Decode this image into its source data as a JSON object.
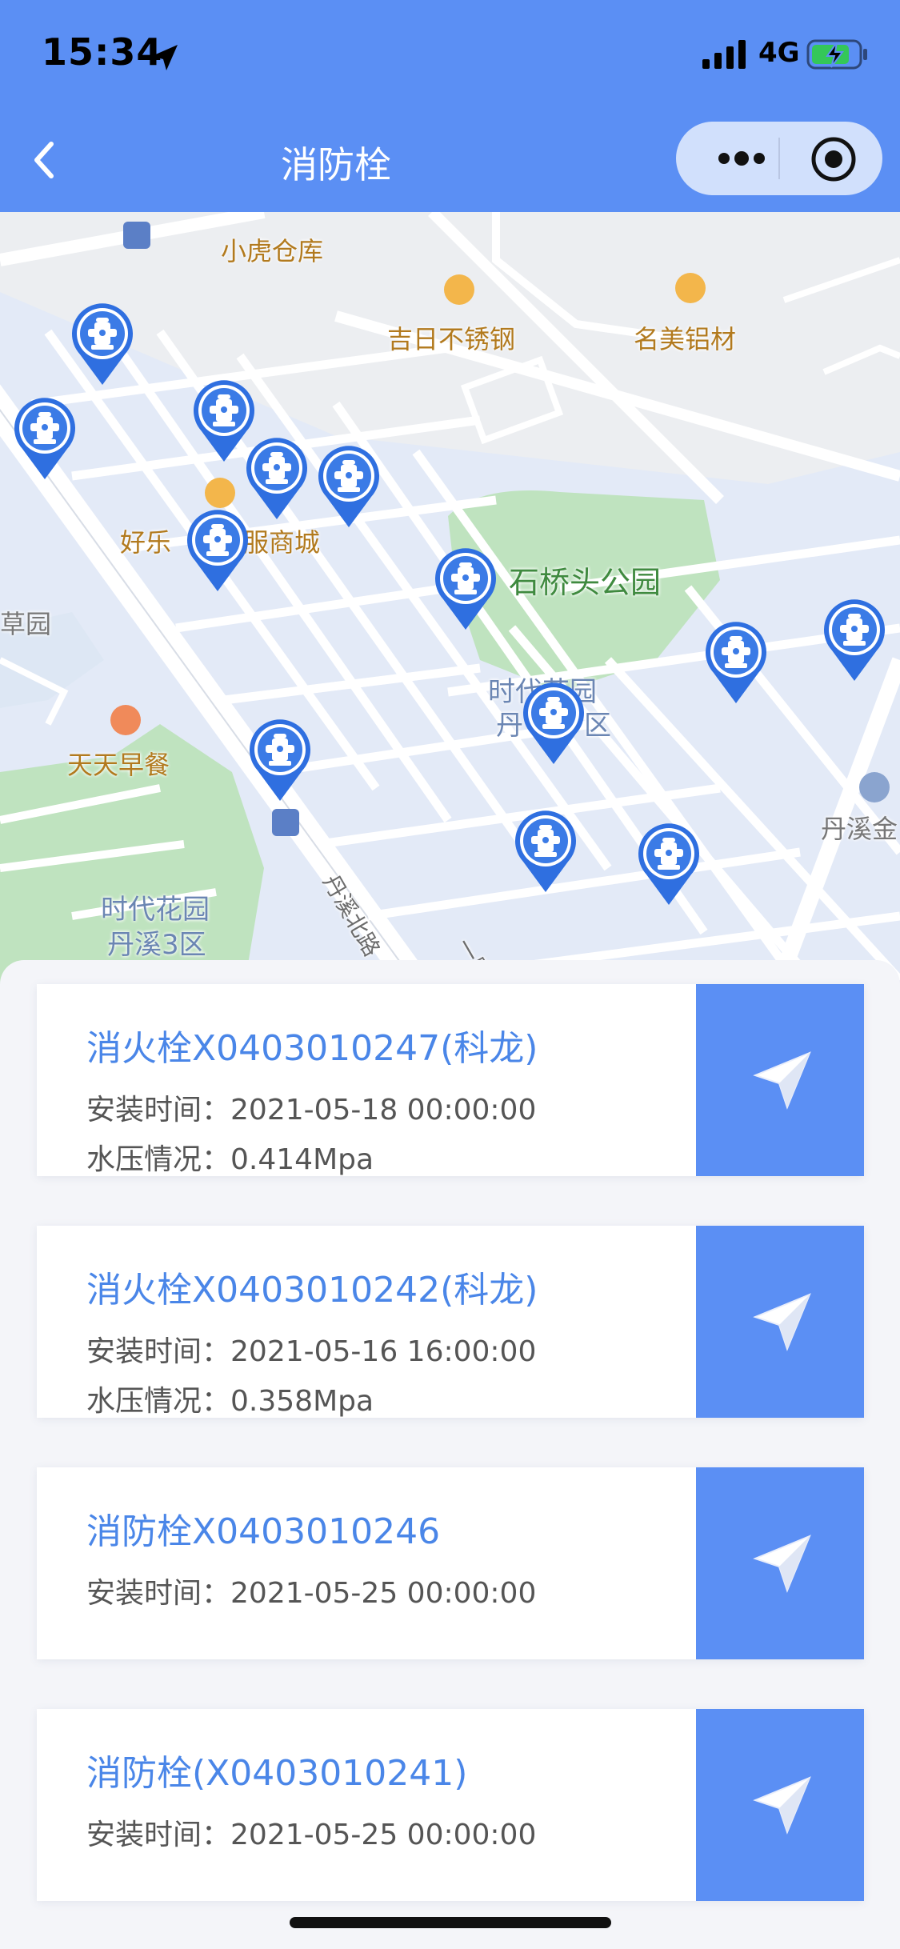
{
  "status_bar": {
    "time": "15:34",
    "network": "4G"
  },
  "nav": {
    "title": "消防栓"
  },
  "map": {
    "labels": {
      "xiaohu": "小虎仓库",
      "jiri": "吉日不锈钢",
      "mingmei": "名美铝材",
      "haole_a": "好乐",
      "haole_b": "服商城",
      "park": "石桥头公园",
      "caoyuan": "草园",
      "breakfast": "天天早餐",
      "shidai_a1": "时代花园",
      "shidai_a2": "丹",
      "shidai_a3": "区",
      "shidai_b1": "时代花园",
      "shidai_b2": "丹溪3区",
      "danxi": "丹溪金",
      "road1": "丹溪北路",
      "road2": "一路"
    }
  },
  "hydrants": [
    {
      "name": "消火栓X0403010247(科龙)",
      "install_label": "安装时间：",
      "install_time": "2021-05-18 00:00:00",
      "pressure_label": "水压情况：",
      "pressure": "0.414Mpa"
    },
    {
      "name": "消火栓X0403010242(科龙)",
      "install_label": "安装时间：",
      "install_time": "2021-05-16 16:00:00",
      "pressure_label": "水压情况：",
      "pressure": "0.358Mpa"
    },
    {
      "name": "消防栓X0403010246",
      "install_label": "安装时间：",
      "install_time": "2021-05-25 00:00:00"
    },
    {
      "name": "消防栓(X0403010241)",
      "install_label": "安装时间：",
      "install_time": "2021-05-25 00:00:00"
    }
  ],
  "colors": {
    "accent": "#5b8ff4",
    "pin": "#2f6fe0",
    "title_text": "#4a86e8"
  }
}
